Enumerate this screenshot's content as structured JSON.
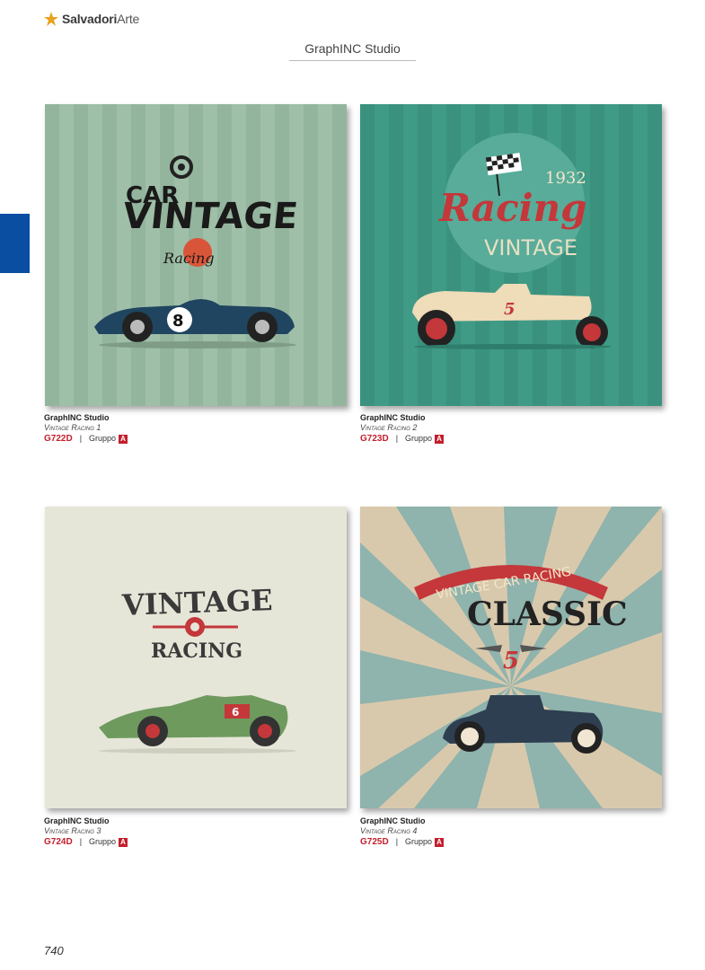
{
  "header": {
    "logo_brand_bold": "Salvadori",
    "logo_brand_light": "Arte",
    "section_title": "GraphINC Studio"
  },
  "products": [
    {
      "brand": "GraphINC Studio",
      "title": "Vintage Racing 1",
      "code": "G722D",
      "separator": "|",
      "group_label": "Gruppo",
      "group_value": "A",
      "art": {
        "line1": "CAR",
        "line2": "VINTAGE",
        "script": "Racing",
        "number": "8",
        "background": "#9fbfa8"
      }
    },
    {
      "brand": "GraphINC Studio",
      "title": "Vintage Racing 2",
      "code": "G723D",
      "separator": "|",
      "group_label": "Gruppo",
      "group_value": "A",
      "art": {
        "year": "1932",
        "script": "Racing",
        "line2": "VINTAGE",
        "number": "5",
        "background": "#3f9a86"
      }
    },
    {
      "brand": "GraphINC Studio",
      "title": "Vintage Racing 3",
      "code": "G724D",
      "separator": "|",
      "group_label": "Gruppo",
      "group_value": "A",
      "art": {
        "line1": "VINTAGE",
        "line2": "RACING",
        "number": "6",
        "background": "#e6e6d8"
      }
    },
    {
      "brand": "GraphINC Studio",
      "title": "Vintage Racing 4",
      "code": "G725D",
      "separator": "|",
      "group_label": "Gruppo",
      "group_value": "A",
      "art": {
        "banner": "VINTAGE CAR RACING",
        "line1": "CLASSIC",
        "number": "5",
        "background": "#d9c9ac"
      }
    }
  ],
  "footer": {
    "page_number": "740"
  },
  "colors": {
    "accent_red": "#c41e2c",
    "side_tab_blue": "#0a4ea2"
  }
}
